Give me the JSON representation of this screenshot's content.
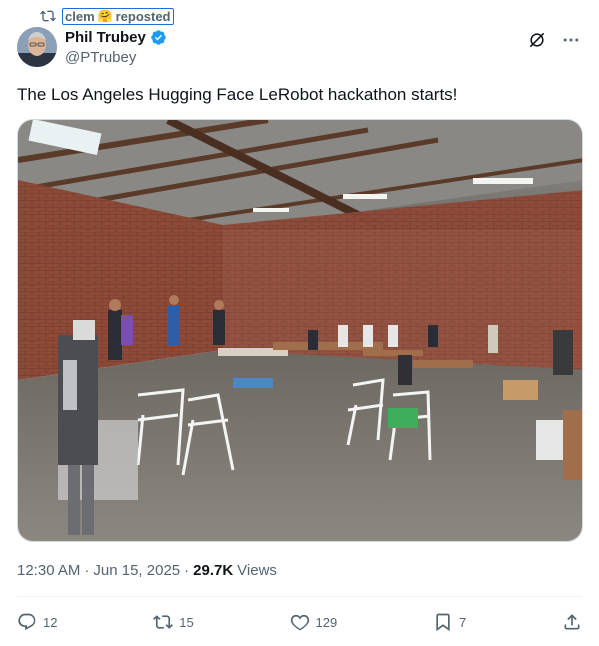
{
  "repost": {
    "user": "clem",
    "emoji": "🤗",
    "label": "reposted"
  },
  "author": {
    "name": "Phil Trubey",
    "handle": "@PTrubey",
    "verified": true
  },
  "tweet": {
    "text": "The Los Angeles Hugging Face LeRobot hackathon starts!"
  },
  "meta": {
    "time": "12:30 AM",
    "date": "Jun 15, 2025",
    "views_count": "29.7K",
    "views_label": "Views",
    "separator": "·"
  },
  "actions": {
    "replies": "12",
    "reposts": "15",
    "likes": "129",
    "bookmarks": "7"
  },
  "colors": {
    "secondary": "#536471",
    "verified": "#1d9bf0",
    "divider": "#eff3f4"
  },
  "icons": [
    "repost-icon",
    "verified-badge-icon",
    "grok-icon",
    "more-icon",
    "reply-icon",
    "like-icon",
    "bookmark-icon",
    "share-icon"
  ]
}
